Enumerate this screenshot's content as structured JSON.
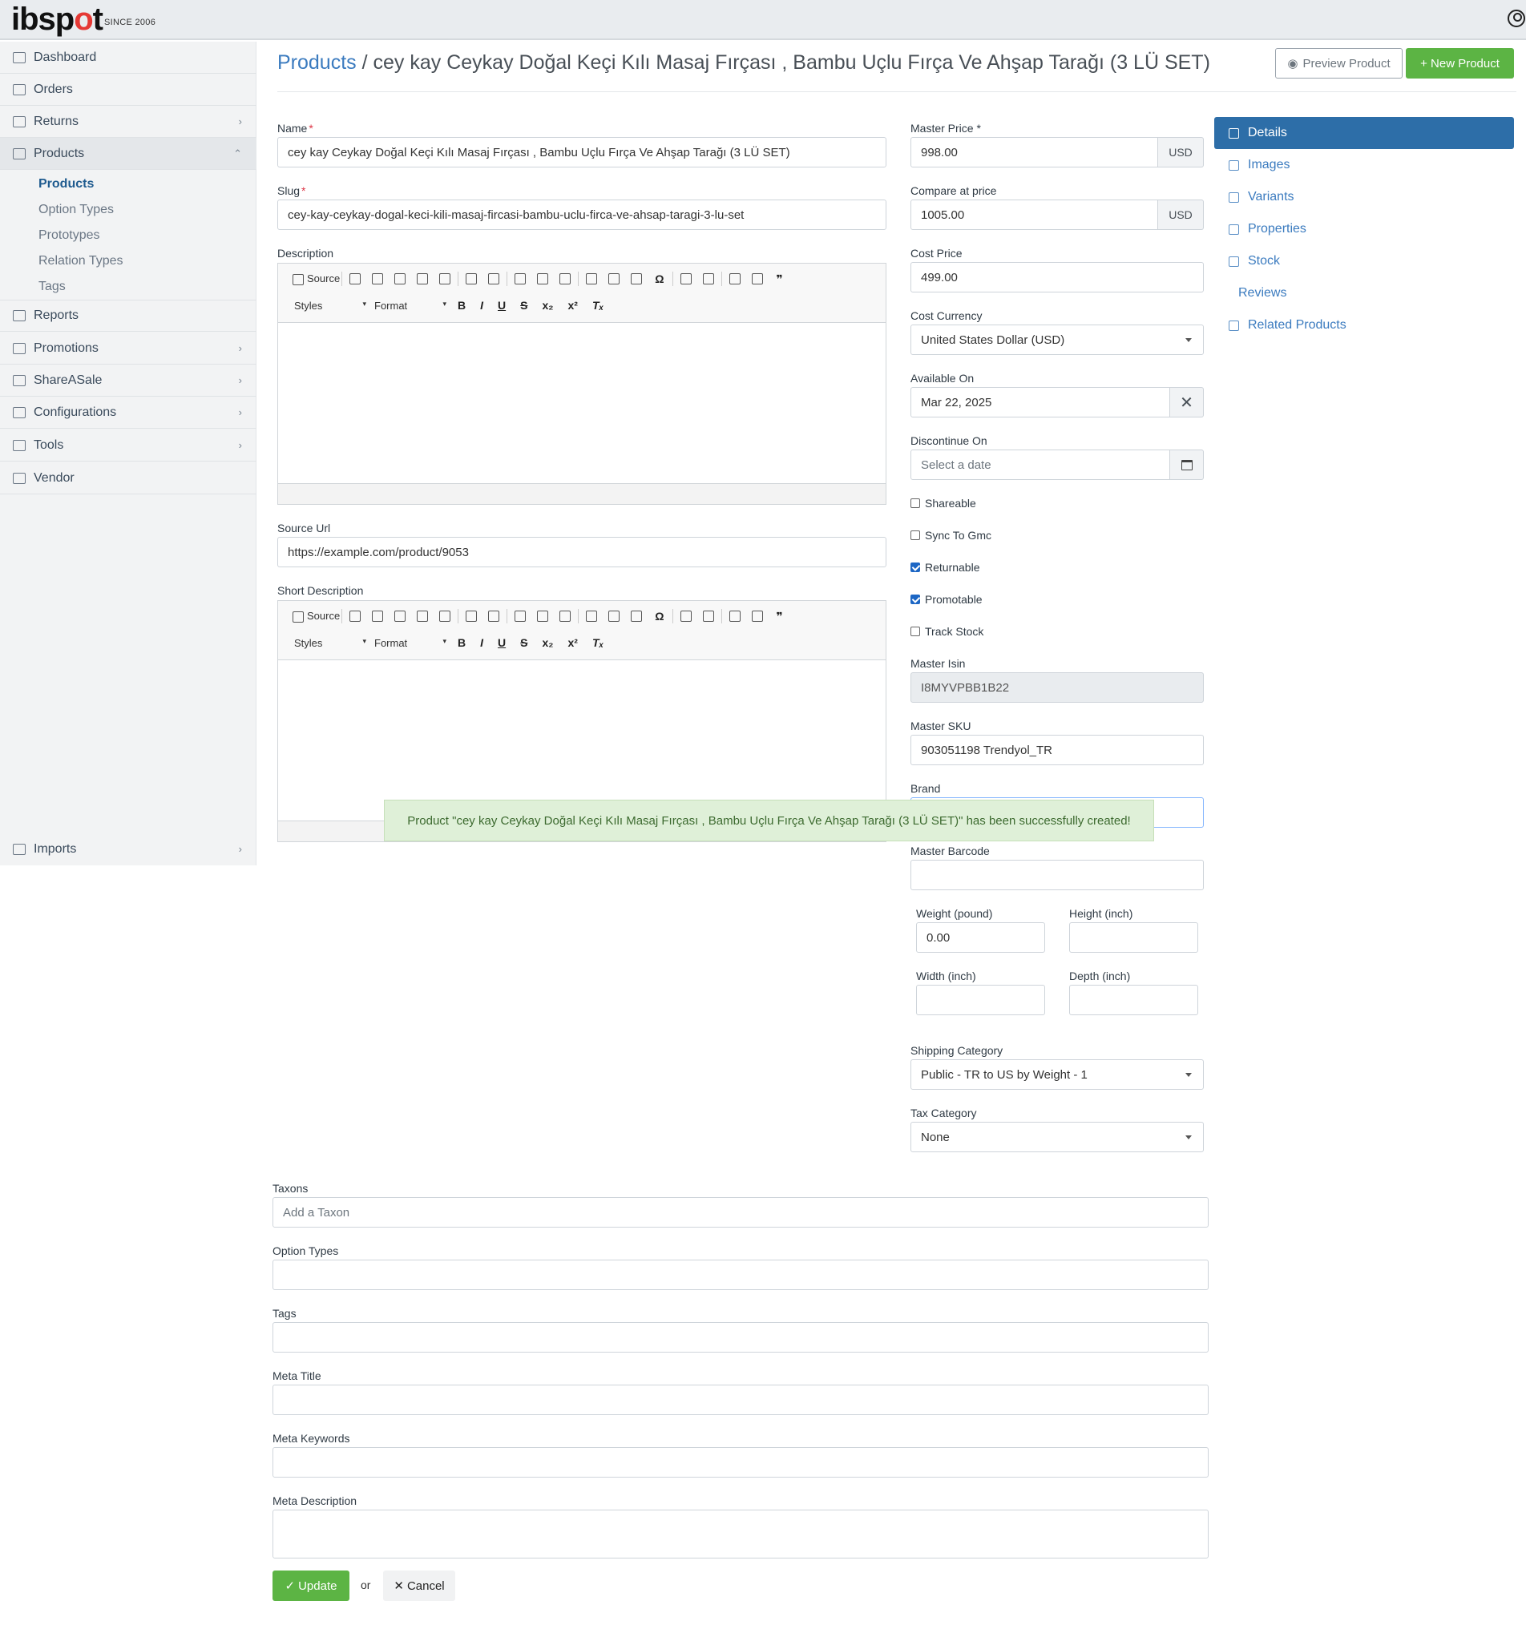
{
  "brand": {
    "logo_a": "ibsp",
    "logo_o": "o",
    "logo_b": "t",
    "since": "SINCE 2006"
  },
  "colors": {
    "primary": "#2d6ea8",
    "success": "#5cb444",
    "link": "#3b7bbf",
    "flash_bg": "#dff0d8"
  },
  "sidebar": {
    "items": [
      {
        "label": "Dashboard",
        "icon": "dashboard-icon"
      },
      {
        "label": "Orders",
        "icon": "orders-icon"
      },
      {
        "label": "Returns",
        "icon": "returns-icon",
        "chev": "›"
      },
      {
        "label": "Products",
        "icon": "products-icon",
        "chev": "⌃"
      },
      {
        "label": "Reports",
        "icon": "reports-icon"
      },
      {
        "label": "Promotions",
        "icon": "promotions-icon",
        "chev": "›"
      },
      {
        "label": "ShareASale",
        "icon": "tag-icon",
        "chev": "›"
      },
      {
        "label": "Configurations",
        "icon": "gear-icon",
        "chev": "›"
      },
      {
        "label": "Tools",
        "icon": "tools-icon",
        "chev": "›"
      },
      {
        "label": "Vendor",
        "icon": "vendor-icon"
      },
      {
        "label": "Imports",
        "icon": "imports-icon",
        "chev": "›"
      }
    ],
    "sub": [
      "Products",
      "Option Types",
      "Prototypes",
      "Relation Types",
      "Tags"
    ]
  },
  "header": {
    "crumb_link": "Products",
    "crumb_sep": " / ",
    "title": "cey kay Ceykay Doğal Keçi Kılı Masaj Fırçası , Bambu Uçlu Fırça Ve Ahşap Tarağı (3 LÜ SET)",
    "preview_label": "Preview Product",
    "new_label": "+ New Product"
  },
  "form": {
    "name_label": "Name",
    "name_value": "cey kay Ceykay Doğal Keçi Kılı Masaj Fırçası , Bambu Uçlu Fırça Ve Ahşap Tarağı (3 LÜ SET)",
    "slug_label": "Slug",
    "slug_value": "cey-kay-ceykay-dogal-keci-kili-masaj-fircasi-bambu-uclu-firca-ve-ahsap-taragi-3-lu-set",
    "description_label": "Description",
    "source_url_label": "Source Url",
    "source_url_value": "https://example.com/product/9053",
    "short_description_label": "Short Description",
    "editor": {
      "source": "Source",
      "styles": "Styles",
      "format": "Format"
    },
    "master_price_label": "Master Price",
    "master_price_value": "998.00",
    "currency": "USD",
    "compare_label": "Compare at price",
    "compare_value": "1005.00",
    "cost_price_label": "Cost Price",
    "cost_price_value": "499.00",
    "cost_currency_label": "Cost Currency",
    "cost_currency_value": "United States Dollar (USD)",
    "available_label": "Available On",
    "available_value": "Mar 22, 2025",
    "discontinue_label": "Discontinue On",
    "discontinue_placeholder": "Select a date",
    "checks": [
      {
        "label": "Shareable",
        "checked": false
      },
      {
        "label": "Sync To Gmc",
        "checked": false
      },
      {
        "label": "Returnable",
        "checked": true
      },
      {
        "label": "Promotable",
        "checked": true
      },
      {
        "label": "Track Stock",
        "checked": false
      }
    ],
    "isin_label": "Master Isin",
    "isin_value": "I8MYVPBB1B22",
    "sku_label": "Master SKU",
    "sku_value": "903051198 Trendyol_TR",
    "brand_label": "Brand",
    "barcode_label": "Master Barcode",
    "weight_label": "Weight (pound)",
    "weight_value": "0.00",
    "height_label": "Height (inch)",
    "width_label": "Width (inch)",
    "depth_label": "Depth (inch)",
    "shipping_label": "Shipping Category",
    "shipping_value": "Public - TR to US by Weight - 1",
    "tax_label": "Tax Category",
    "tax_value": "None",
    "taxons_label": "Taxons",
    "taxons_placeholder": "Add a Taxon",
    "option_types_label": "Option Types",
    "tags_label": "Tags",
    "meta_title_label": "Meta Title",
    "meta_keywords_label": "Meta Keywords",
    "meta_description_label": "Meta Description",
    "update_label": "Update",
    "or": "or",
    "cancel_label": "Cancel"
  },
  "tabs": [
    "Details",
    "Images",
    "Variants",
    "Properties",
    "Stock",
    "Reviews",
    "Related Products"
  ],
  "flash": "Product \"cey kay Ceykay Doğal Keçi Kılı Masaj Fırçası , Bambu Uçlu Fırça Ve Ahşap Tarağı (3 LÜ SET)\" has been successfully created!"
}
